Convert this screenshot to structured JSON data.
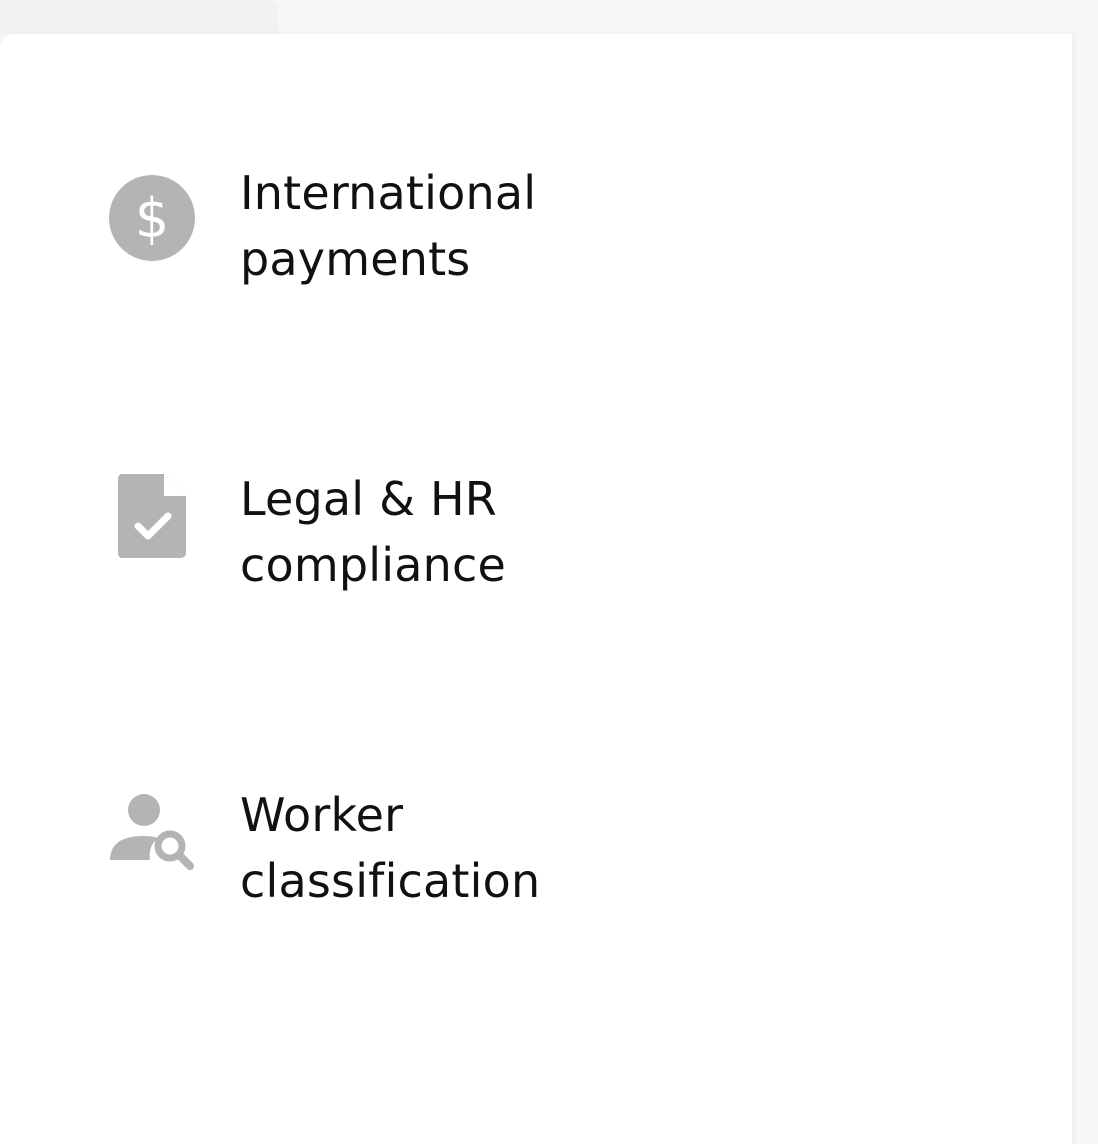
{
  "features": [
    {
      "line1": "International",
      "line2": "payments",
      "icon": "dollar-circle-icon"
    },
    {
      "line1": "Legal & HR",
      "line2": "compliance",
      "icon": "document-check-icon"
    },
    {
      "line1": "Worker",
      "line2": "classification",
      "icon": "person-search-icon"
    }
  ],
  "colors": {
    "icon": "#b4b4b4",
    "text": "#111111",
    "card": "#ffffff",
    "page": "#f7f7f7"
  }
}
